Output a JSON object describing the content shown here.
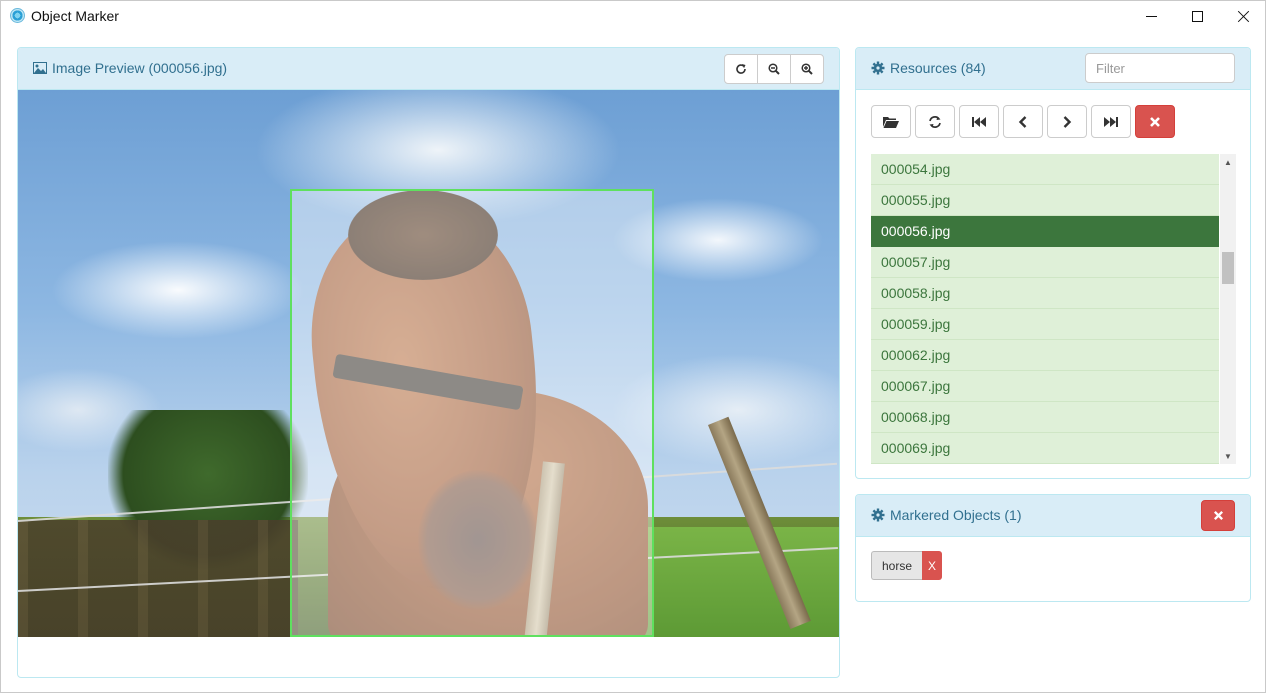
{
  "window": {
    "title": "Object Marker"
  },
  "preview": {
    "title": "Image Preview (000056.jpg)",
    "tools": [
      "refresh-icon",
      "zoom-out-icon",
      "zoom-in-icon"
    ],
    "bbox_label": "horse",
    "bbox_color": "#5fe05f"
  },
  "resources": {
    "title": "Resources (84)",
    "filter_placeholder": "Filter",
    "toolbar_icons": [
      "folder-open-icon",
      "refresh-icon",
      "first-icon",
      "prev-icon",
      "next-icon",
      "last-icon",
      "delete-icon"
    ],
    "files": [
      {
        "name": "000054.jpg",
        "active": false
      },
      {
        "name": "000055.jpg",
        "active": false
      },
      {
        "name": "000056.jpg",
        "active": true
      },
      {
        "name": "000057.jpg",
        "active": false
      },
      {
        "name": "000058.jpg",
        "active": false
      },
      {
        "name": "000059.jpg",
        "active": false
      },
      {
        "name": "000062.jpg",
        "active": false
      },
      {
        "name": "000067.jpg",
        "active": false
      },
      {
        "name": "000068.jpg",
        "active": false
      },
      {
        "name": "000069.jpg",
        "active": false
      }
    ]
  },
  "objects": {
    "title": "Markered Objects (1)",
    "items": [
      {
        "label": "horse",
        "remove": "X"
      }
    ]
  },
  "colors": {
    "heading_bg": "#d9edf7",
    "heading_text": "#31708f",
    "list_bg": "#dff0d8",
    "list_text": "#3c763d",
    "list_active_bg": "#3c763d",
    "danger": "#d9534f"
  }
}
